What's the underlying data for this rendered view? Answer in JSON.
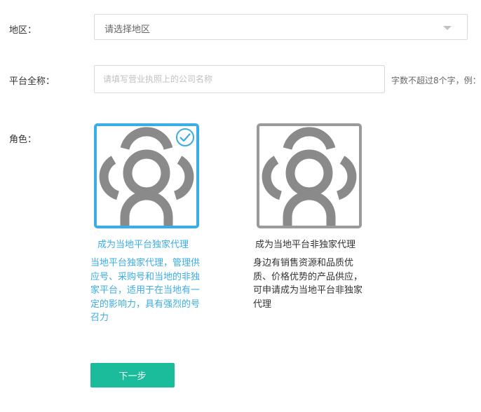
{
  "form": {
    "region": {
      "label": "地区：",
      "placeholder": "请选择地区"
    },
    "platform_name": {
      "label": "平台全称：",
      "placeholder": "请填写营业执照上的公司名称",
      "value": "",
      "hint": "字数不超过8个字，例："
    },
    "role": {
      "label": "角色："
    }
  },
  "roles": [
    {
      "title": "成为当地平台独家代理",
      "description": "当地平台独家代理，管理供应号、采购号和当地的非独家平台，适用于在当地有一定的影响力，具有强烈的号召力",
      "selected": true
    },
    {
      "title": "成为当地平台非独家代理",
      "description": "身边有销售资源和品质优质、价格优势的产品供应，可申请成为当地平台非独家代理",
      "selected": false
    }
  ],
  "actions": {
    "next_label": "下一步"
  },
  "colors": {
    "accent": "#3aade6",
    "primary_button": "#1bbc9b",
    "unselected_border": "#9a9a9a",
    "icon_fill": "#8a8a8a"
  },
  "icons": {
    "role_icon": "user-group-icon",
    "check": "check-circle-icon",
    "dropdown": "caret-down-icon"
  }
}
